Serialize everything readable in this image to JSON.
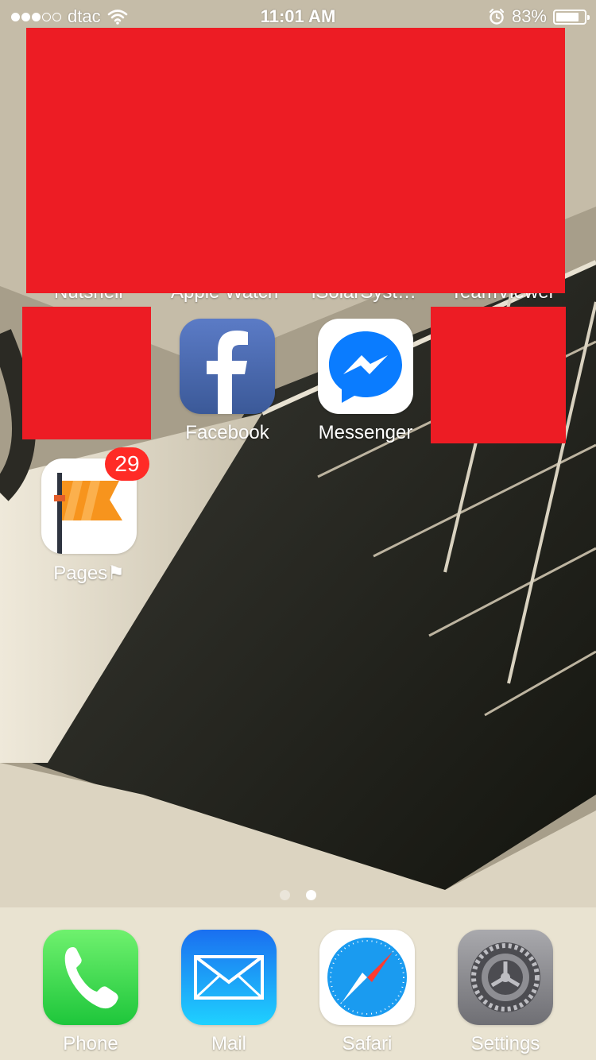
{
  "status_bar": {
    "signal_bars_filled": 3,
    "signal_bars_total": 5,
    "carrier": "dtac",
    "time": "11:01 AM",
    "battery_percent": "83%",
    "battery_level": 0.83
  },
  "partial_labels": [
    "Nutshell",
    "Apple Watch",
    "iSolarSyst…",
    "TeamViewer"
  ],
  "home_apps": [
    {
      "name": "Facebook",
      "icon": "facebook-icon"
    },
    {
      "name": "Messenger",
      "icon": "messenger-icon"
    },
    {
      "name": "Pages⚑",
      "icon": "pages-flag-icon",
      "badge": "29"
    }
  ],
  "page_indicator": {
    "pages": 2,
    "current": 2
  },
  "dock": [
    {
      "name": "Phone",
      "icon": "phone-icon"
    },
    {
      "name": "Mail",
      "icon": "mail-icon"
    },
    {
      "name": "Safari",
      "icon": "safari-compass-icon"
    },
    {
      "name": "Settings",
      "icon": "settings-gear-icon"
    }
  ],
  "colors": {
    "redaction": "#ed1c24",
    "badge": "#ff2b26",
    "facebook": "#3b5998",
    "messenger": "#0084ff",
    "phone": "#2ecc40",
    "mail": "#1e90ff",
    "pages_flag": "#f7941d"
  }
}
